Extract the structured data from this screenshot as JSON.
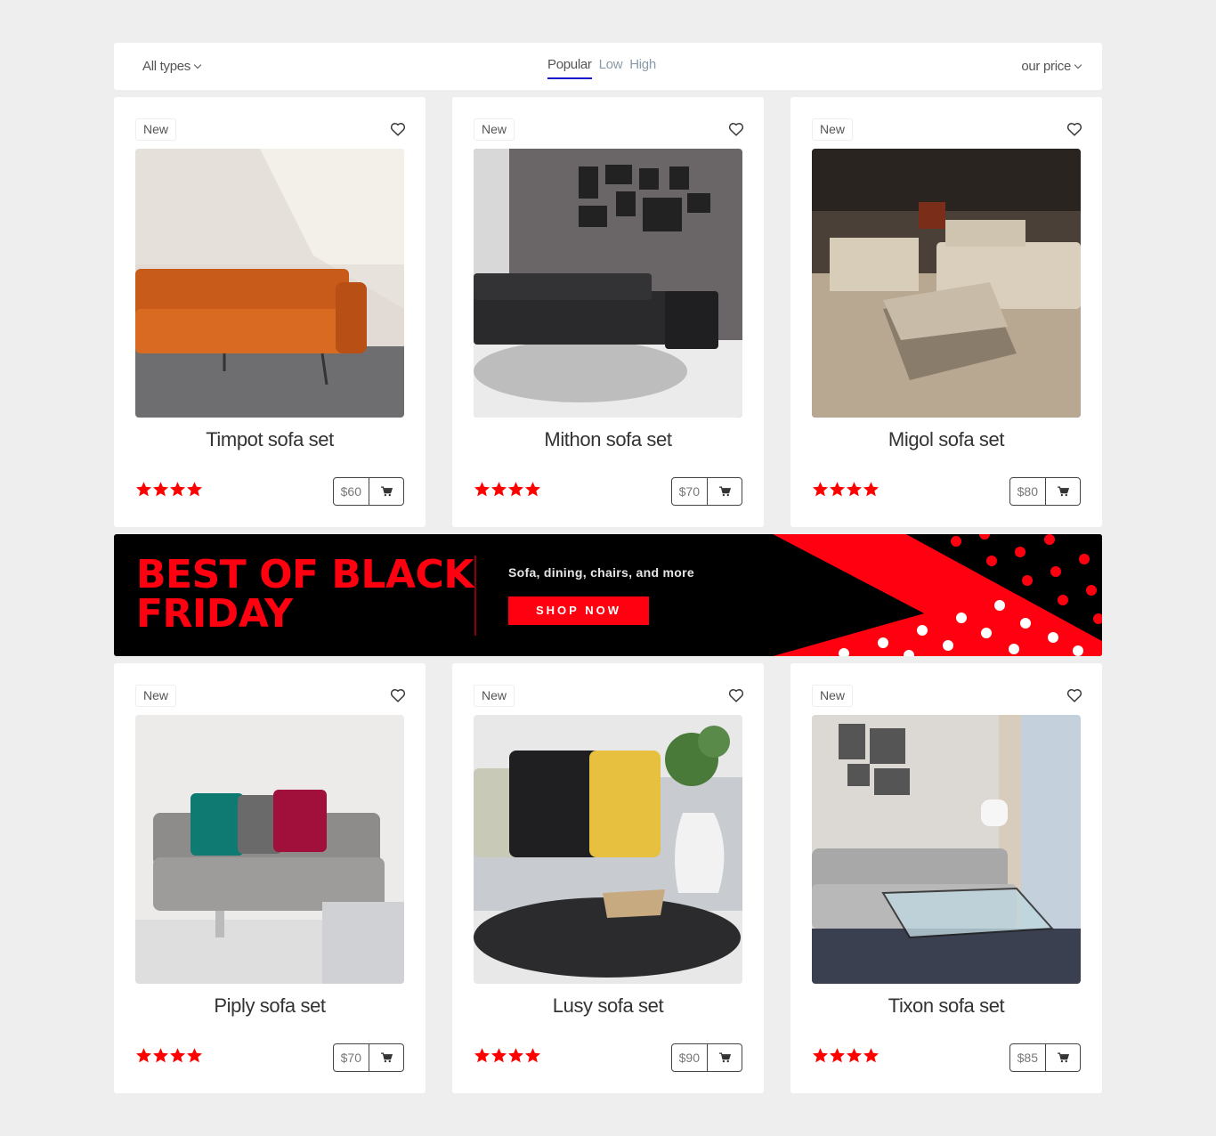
{
  "filters": {
    "type_dropdown": "All types",
    "sort_tabs": [
      {
        "label": "Popular",
        "active": true
      },
      {
        "label": "Low",
        "active": false
      },
      {
        "label": "High",
        "active": false
      }
    ],
    "price_dropdown": "our price"
  },
  "products": [
    {
      "badge": "New",
      "name": "Timpot sofa set",
      "price": "$60",
      "rating": 4,
      "image": "orange-leather-sofa"
    },
    {
      "badge": "New",
      "name": "Mithon sofa set",
      "price": "$70",
      "rating": 4,
      "image": "black-sectional-sofa"
    },
    {
      "badge": "New",
      "name": "Migol sofa set",
      "price": "$80",
      "rating": 4,
      "image": "showroom-beige-sofas"
    },
    {
      "badge": "New",
      "name": "Piply sofa set",
      "price": "$70",
      "rating": 4,
      "image": "grey-sofa-colored-pillows"
    },
    {
      "badge": "New",
      "name": "Lusy sofa set",
      "price": "$90",
      "rating": 4,
      "image": "cushions-vase-coffee-table"
    },
    {
      "badge": "New",
      "name": "Tixon sofa set",
      "price": "$85",
      "rating": 4,
      "image": "living-room-glass-table"
    }
  ],
  "banner": {
    "headline_line1": "BEST OF BLACK",
    "headline_line2": "FRIDAY",
    "subtitle": "Sofa, dining, chairs, and more",
    "cta": "SHOP NOW"
  },
  "colors": {
    "accent_red": "#ff0010",
    "tab_underline": "#1a10c8",
    "star": "#ff0000"
  }
}
